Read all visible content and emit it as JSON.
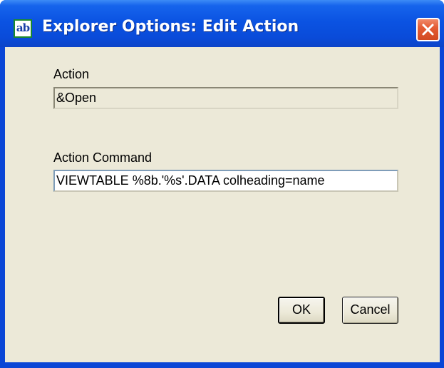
{
  "window": {
    "title": "Explorer Options: Edit Action",
    "icon_text": "ab",
    "icon": "text-field-icon",
    "close_icon": "close-icon"
  },
  "form": {
    "action_label": "Action",
    "action_value": "&Open",
    "command_label": "Action Command",
    "command_value": "VIEWTABLE %8b.'%s'.DATA colheading=name"
  },
  "buttons": {
    "ok_label": "OK",
    "cancel_label": "Cancel"
  },
  "colors": {
    "titlebar": "#0a4bd9",
    "client": "#ece9d8",
    "close_button": "#e45c34"
  }
}
